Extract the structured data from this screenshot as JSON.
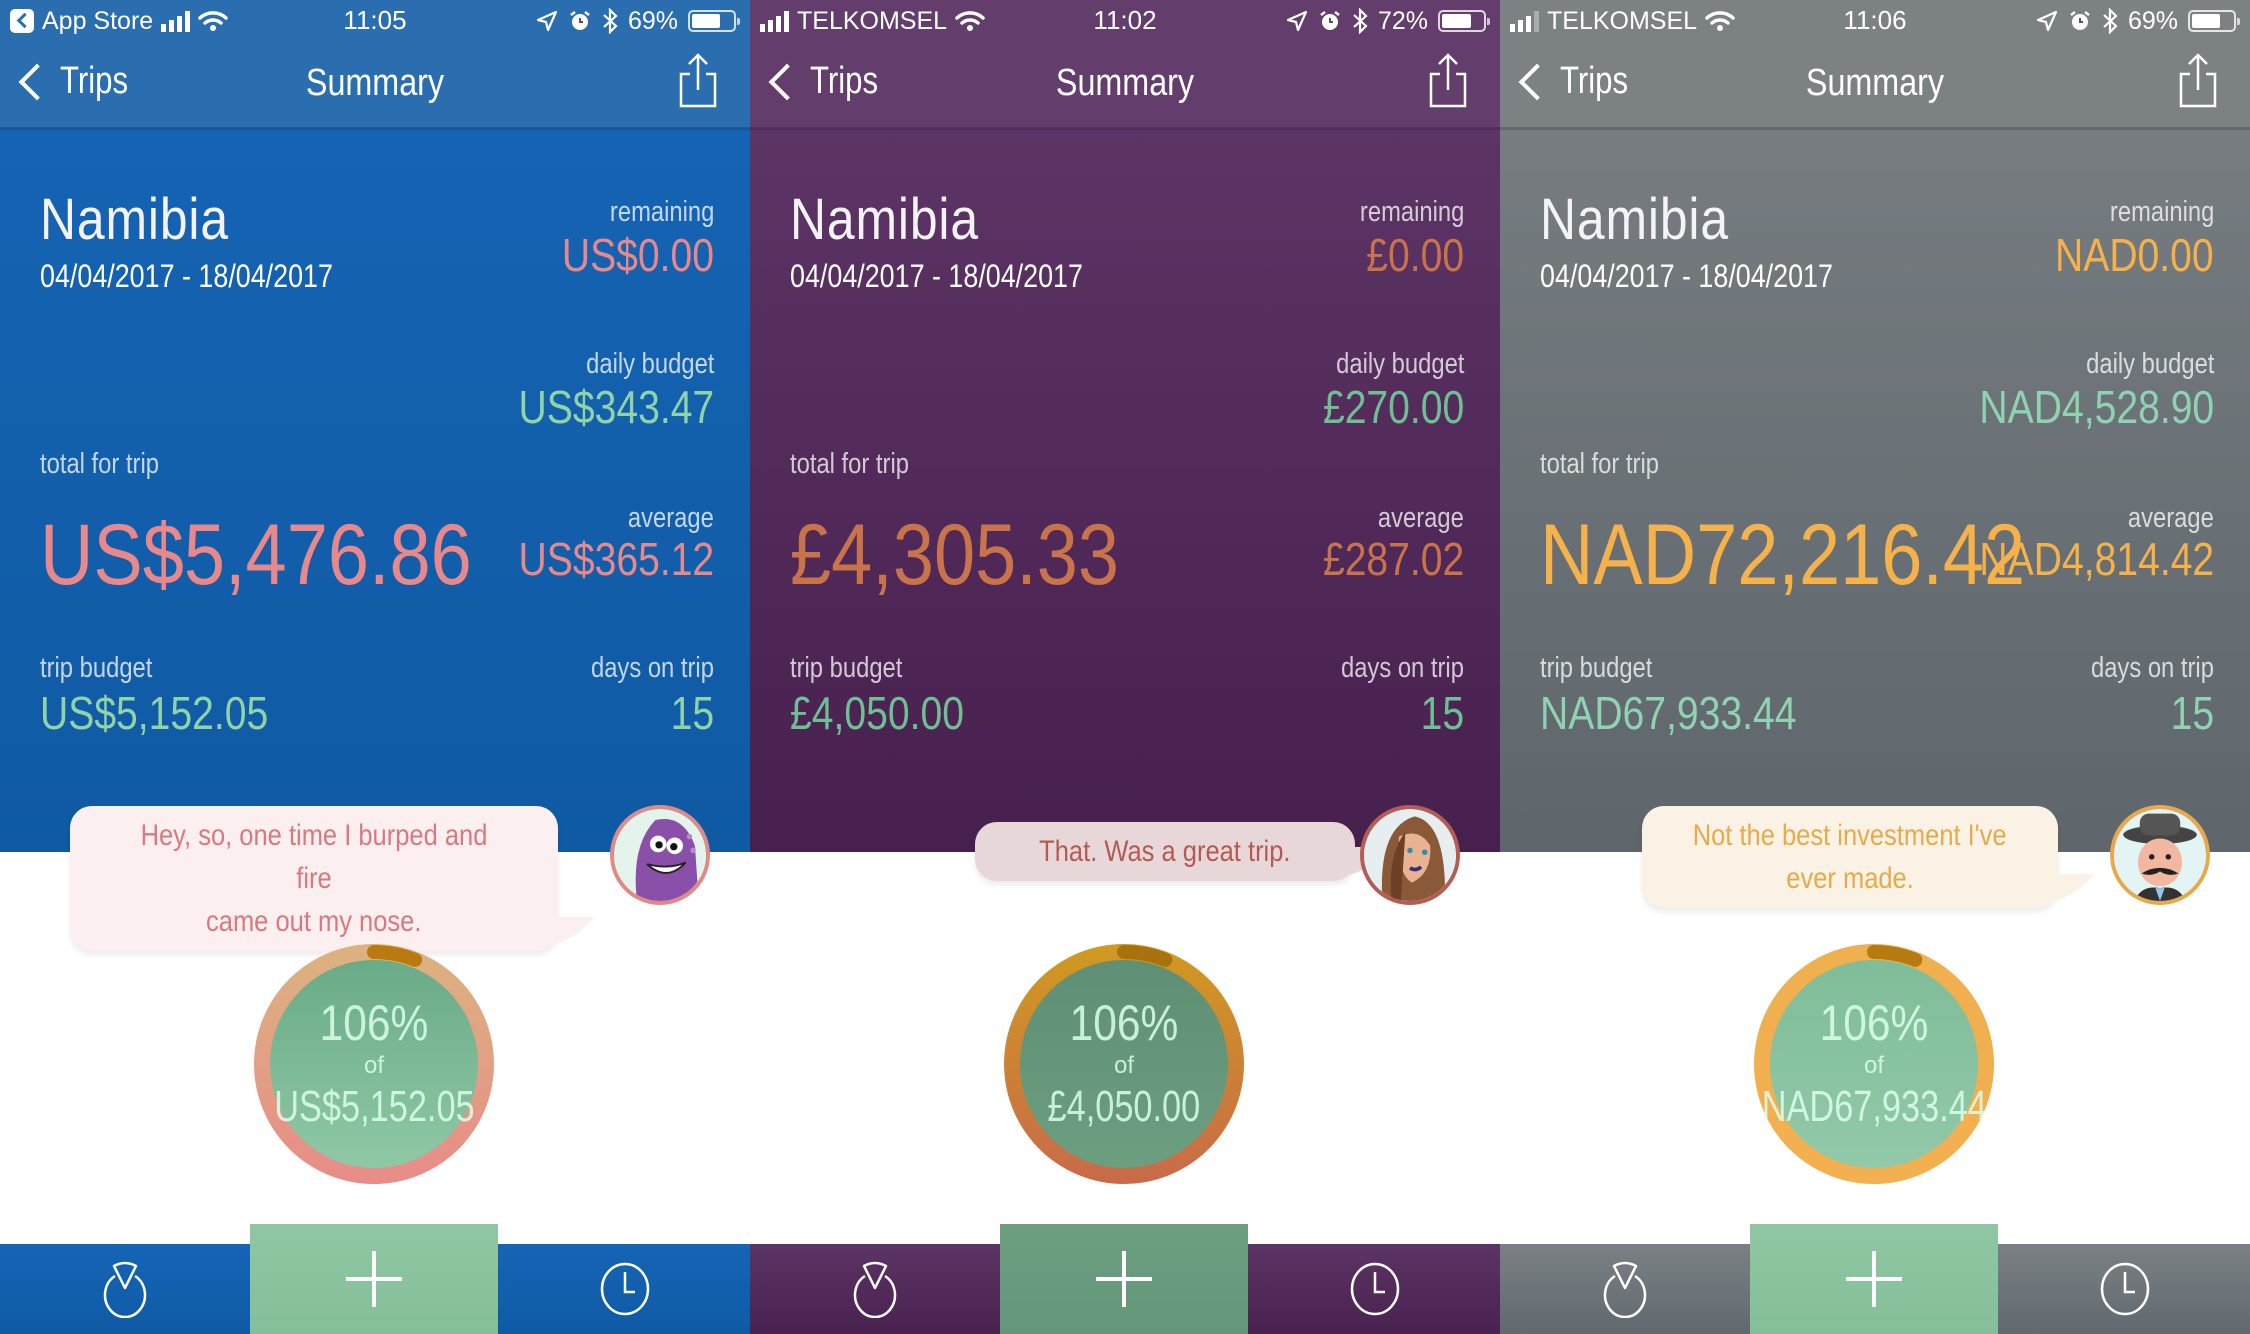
{
  "screens": [
    {
      "theme": "blue",
      "status_bar": {
        "carrier": "App Store",
        "time": "11:05",
        "battery": "69%",
        "battery_level": 0.69,
        "signal_bars": 4
      },
      "nav": {
        "back_label": "Trips",
        "title": "Summary"
      },
      "trip": {
        "name": "Namibia",
        "dates": "04/04/2017 - 18/04/2017"
      },
      "stats": {
        "remaining_label": "remaining",
        "remaining": "US$0.00",
        "daily_budget_label": "daily budget",
        "daily_budget": "US$343.47",
        "total_label": "total for trip",
        "total": "US$5,476.86",
        "average_label": "average",
        "average": "US$365.12",
        "trip_budget_label": "trip budget",
        "trip_budget": "US$5,152.05",
        "days_label": "days on trip",
        "days": "15"
      },
      "bubble": {
        "line1": "Hey, so, one time I burped and fire",
        "line2": "came out my nose."
      },
      "avatar": "purple-monster",
      "ring": {
        "percent_label": "106%",
        "of_label": "of",
        "amount": "US$5,152.05",
        "percent": 106
      },
      "colors": {
        "red": "#e8888a",
        "green": "#8fd3a6",
        "bubble_bg": "#fcefef",
        "bubble_text": "#d9787e",
        "avatar_border": "#e08a86",
        "ring_top": "#dcb380",
        "ring_bottom": "#e88c88",
        "ring_over": "#b97a10",
        "ring_fill_top": "#6aab88",
        "ring_fill_bottom": "#8fc8a4"
      }
    },
    {
      "theme": "purple",
      "status_bar": {
        "carrier": "TELKOMSEL",
        "time": "11:02",
        "battery": "72%",
        "battery_level": 0.72,
        "signal_bars": 4
      },
      "nav": {
        "back_label": "Trips",
        "title": "Summary"
      },
      "trip": {
        "name": "Namibia",
        "dates": "04/04/2017 - 18/04/2017"
      },
      "stats": {
        "remaining_label": "remaining",
        "remaining": "£0.00",
        "daily_budget_label": "daily budget",
        "daily_budget": "£270.00",
        "total_label": "total for trip",
        "total": "£4,305.33",
        "average_label": "average",
        "average": "£287.02",
        "trip_budget_label": "trip budget",
        "trip_budget": "£4,050.00",
        "days_label": "days on trip",
        "days": "15"
      },
      "bubble": {
        "line1": "That. Was a great trip.",
        "line2": ""
      },
      "avatar": "brunette-woman",
      "ring": {
        "percent_label": "106%",
        "of_label": "of",
        "amount": "£4,050.00",
        "percent": 106
      },
      "colors": {
        "red": "#c8734a",
        "green": "#6fbf95",
        "bubble_bg": "#e8d7d9",
        "bubble_text": "#b35a52",
        "avatar_border": "#b55d55",
        "ring_top": "#d19a1f",
        "ring_bottom": "#c86a4a",
        "ring_over": "#a8720f",
        "ring_fill_top": "#5f8f74",
        "ring_fill_bottom": "#6c9e80"
      }
    },
    {
      "theme": "gray",
      "status_bar": {
        "carrier": "TELKOMSEL",
        "time": "11:06",
        "battery": "69%",
        "battery_level": 0.69,
        "signal_bars": 3
      },
      "nav": {
        "back_label": "Trips",
        "title": "Summary"
      },
      "trip": {
        "name": "Namibia",
        "dates": "04/04/2017 - 18/04/2017"
      },
      "stats": {
        "remaining_label": "remaining",
        "remaining": "NAD0.00",
        "daily_budget_label": "daily budget",
        "daily_budget": "NAD4,528.90",
        "total_label": "total for trip",
        "total": "NAD72,216.42",
        "average_label": "average",
        "average": "NAD4,814.42",
        "trip_budget_label": "trip budget",
        "trip_budget": "NAD67,933.44",
        "days_label": "days on trip",
        "days": "15"
      },
      "bubble": {
        "line1": "Not the best investment I've",
        "line2": "ever made."
      },
      "avatar": "mustached-gentleman",
      "ring": {
        "percent_label": "106%",
        "of_label": "of",
        "amount": "NAD67,933.44",
        "percent": 106
      },
      "colors": {
        "red": "#f5b24a",
        "green": "#8fd3b0",
        "bubble_bg": "#fbf2e6",
        "bubble_text": "#e8a94a",
        "avatar_border": "#e8a94a",
        "ring_top": "#f0b050",
        "ring_bottom": "#f2b050",
        "ring_over": "#b57a10",
        "ring_fill_top": "#7fbd98",
        "ring_fill_bottom": "#92c9a9"
      }
    }
  ],
  "tabbar": {
    "left_icon": "pie-chart-icon",
    "center_icon": "plus-icon",
    "right_icon": "clock-icon"
  }
}
